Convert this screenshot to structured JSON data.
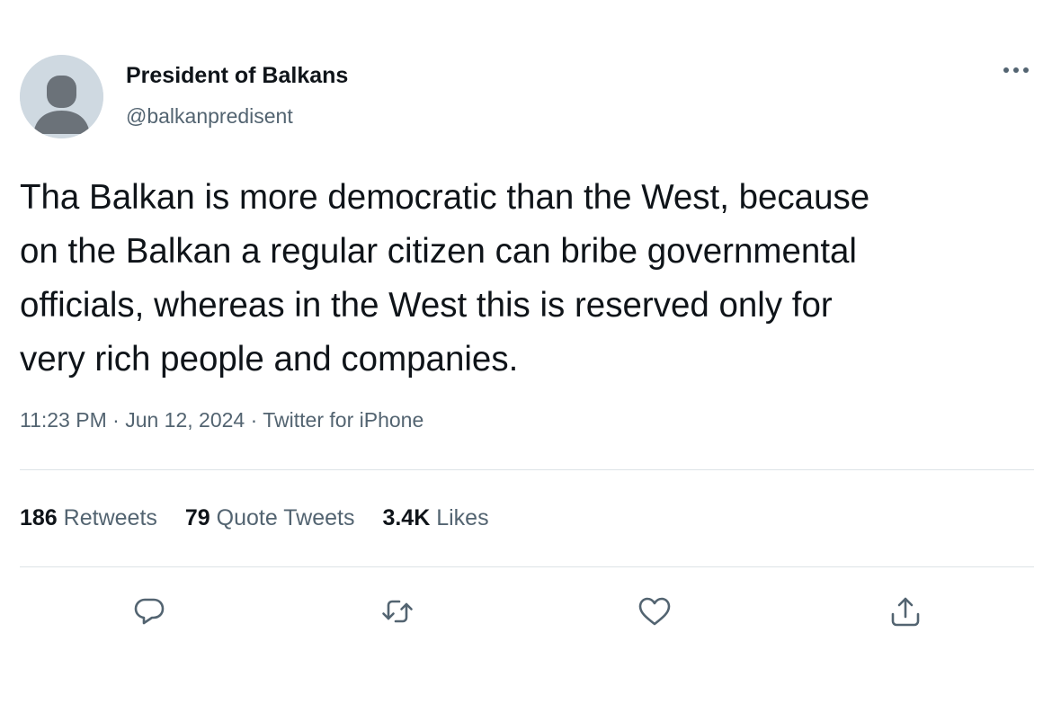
{
  "author": {
    "display_name": "President of Balkans",
    "handle": "@balkanpredisent",
    "avatar_icon": "default-profile-icon"
  },
  "tweet": {
    "lines": [
      "Tha Balkan is more democratic than the West, because",
      "on the Balkan a regular citizen can bribe governmental",
      "officials, whereas in the West this is reserved only for",
      "very rich people and companies."
    ],
    "time": "11:23 PM",
    "date": "Jun 12, 2024",
    "separator": "·",
    "source": "Twitter for iPhone"
  },
  "stats": {
    "retweets": {
      "count": "186",
      "label": "Retweets"
    },
    "quotes": {
      "count": "79",
      "label": "Quote Tweets"
    },
    "likes": {
      "count": "3.4K",
      "label": "Likes"
    }
  },
  "actions": [
    "reply-icon",
    "retweet-icon",
    "like-icon",
    "share-icon"
  ],
  "colors": {
    "text": "#0f1419",
    "secondary": "#536471",
    "divider": "#dde3e7",
    "avatar_bg": "#cfd9e1",
    "avatar_fg": "#6b7279"
  }
}
